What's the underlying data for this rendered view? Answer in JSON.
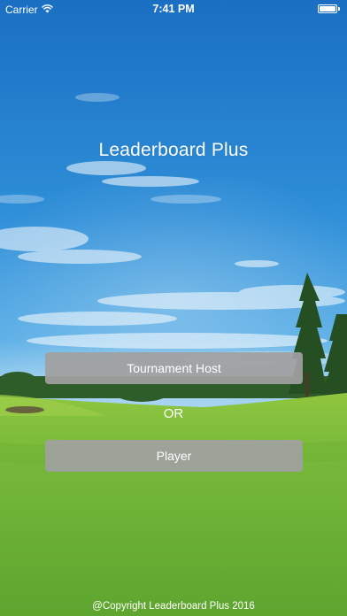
{
  "status_bar": {
    "carrier": "Carrier",
    "time": "7:41 PM"
  },
  "app": {
    "title": "Leaderboard Plus"
  },
  "buttons": {
    "tournament_host": "Tournament Host",
    "or": "OR",
    "player": "Player"
  },
  "footer": {
    "copyright": "@Copyright Leaderboard Plus 2016"
  },
  "colors": {
    "button_bg": "#a0a0a0",
    "text": "#ffffff",
    "sky_top": "#1c78c8",
    "grass": "#7cbd3c"
  },
  "icons": [
    "wifi-icon",
    "battery-icon"
  ]
}
